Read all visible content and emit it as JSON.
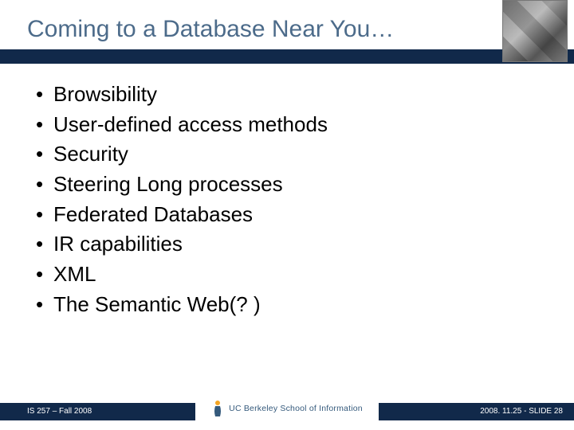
{
  "title": "Coming to a Database Near You…",
  "bullets": [
    "Browsibility",
    "User-defined access methods",
    "Security",
    "Steering Long processes",
    "Federated Databases",
    "IR capabilities",
    "XML",
    "The Semantic Web(? )"
  ],
  "footer": {
    "left": "IS 257 – Fall 2008",
    "right": "2008. 11.25 - SLIDE 28",
    "logo_text": "UC Berkeley School of Information"
  }
}
